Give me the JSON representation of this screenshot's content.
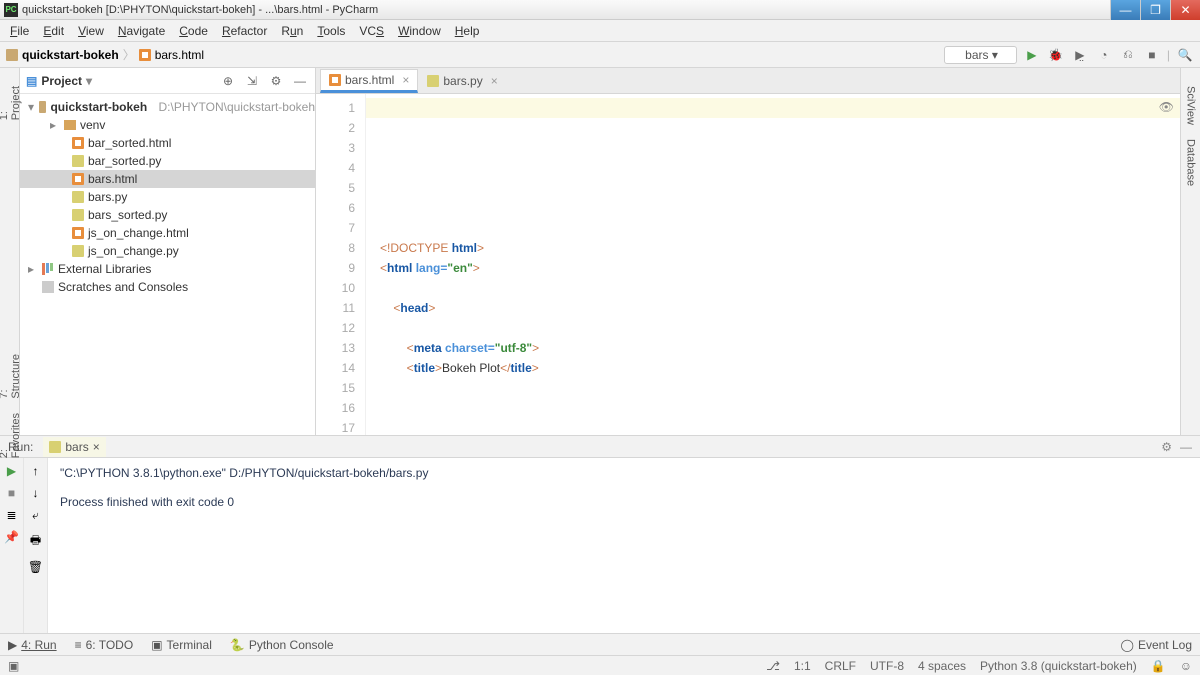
{
  "window": {
    "title": "quickstart-bokeh [D:\\PHYTON\\quickstart-bokeh] - ...\\bars.html - PyCharm"
  },
  "menu": [
    "File",
    "Edit",
    "View",
    "Navigate",
    "Code",
    "Refactor",
    "Run",
    "Tools",
    "VCS",
    "Window",
    "Help"
  ],
  "breadcrumb": {
    "root": "quickstart-bokeh",
    "file": "bars.html"
  },
  "run_config": "bars",
  "sidebar_left": [
    "1: Project",
    "7: Structure",
    "2: Favorites"
  ],
  "sidebar_right": [
    "SciView",
    "Database"
  ],
  "project": {
    "title": "Project",
    "root": {
      "name": "quickstart-bokeh",
      "path": "D:\\PHYTON\\quickstart-bokeh"
    },
    "venv": "venv",
    "files": [
      "bar_sorted.html",
      "bar_sorted.py",
      "bars.html",
      "bars.py",
      "bars_sorted.py",
      "js_on_change.html",
      "js_on_change.py"
    ],
    "extlib": "External Libraries",
    "scratches": "Scratches and Consoles"
  },
  "editor_tabs": [
    {
      "label": "bars.html",
      "active": true,
      "type": "html"
    },
    {
      "label": "bars.py",
      "active": false,
      "type": "py"
    }
  ],
  "editor": {
    "line_count": 17,
    "lines": [
      "",
      "",
      "",
      "",
      "<!DOCTYPE html>",
      "<html lang=\"en\">",
      "",
      "    <head>",
      "",
      "        <meta charset=\"utf-8\">",
      "        <title>Bokeh Plot</title>",
      "",
      "",
      "",
      "",
      "",
      ""
    ]
  },
  "run": {
    "label": "Run:",
    "tab": "bars",
    "output_line1": "\"C:\\PYTHON 3.8.1\\python.exe\" D:/PHYTON/quickstart-bokeh/bars.py",
    "output_line2": "Process finished with exit code 0"
  },
  "bottom": {
    "run": "4: Run",
    "todo": "6: TODO",
    "terminal": "Terminal",
    "pyconsole": "Python Console",
    "eventlog": "Event Log"
  },
  "status": {
    "pos": "1:1",
    "lineend": "CRLF",
    "encoding": "UTF-8",
    "indent": "4 spaces",
    "interpreter": "Python 3.8 (quickstart-bokeh)"
  }
}
